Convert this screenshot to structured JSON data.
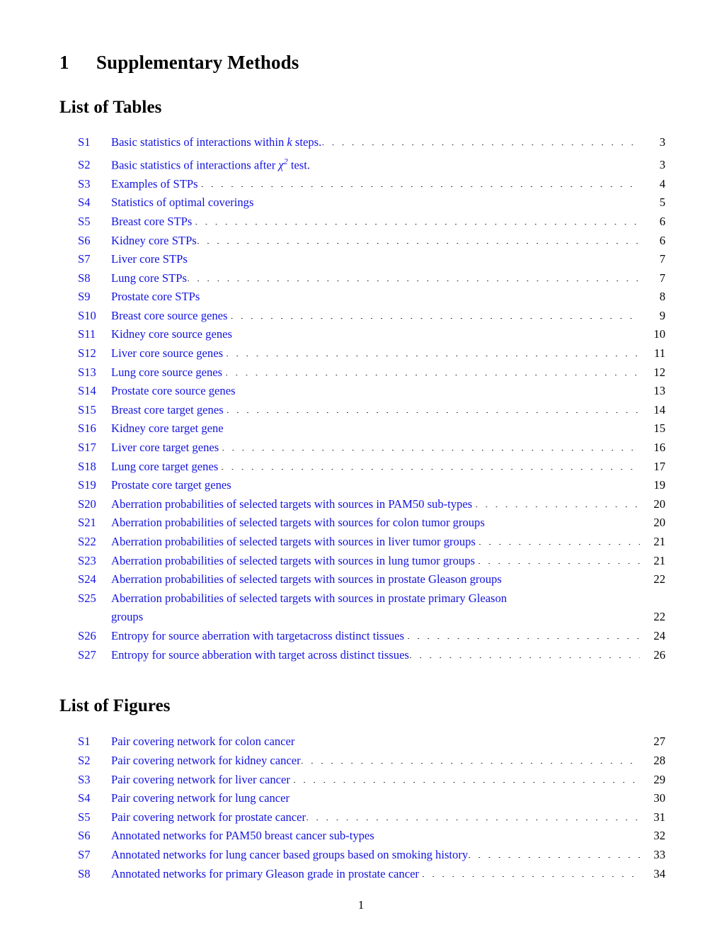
{
  "document": {
    "section_number": "1",
    "section_title": "Supplementary Methods",
    "page_footer": "1",
    "link_color": "#1414e0",
    "text_color": "#000000"
  },
  "tables": {
    "heading": "List of Tables",
    "entries": [
      {
        "label": "S1",
        "title_pre": "Basic statistics of interactions within ",
        "math": "k",
        "title_post": " steps.",
        "page": "3",
        "leader": "tight"
      },
      {
        "label": "S2",
        "title_pre": "Basic statistics of interactions after ",
        "math_chi": "χ",
        "math_sup": "2",
        "title_post": " test.",
        "page": "3",
        "leader": "tight"
      },
      {
        "label": "S3",
        "title": "Examples of STPs",
        "page": "4",
        "leader": "normal"
      },
      {
        "label": "S4",
        "title": "Statistics of optimal coverings",
        "page": "5",
        "leader": "normal"
      },
      {
        "label": "S5",
        "title": "Breast core STPs",
        "page": "6",
        "leader": "normal"
      },
      {
        "label": "S6",
        "title": "Kidney core STPs",
        "page": "6",
        "leader": "tight"
      },
      {
        "label": "S7",
        "title": "Liver core STPs",
        "page": "7",
        "leader": "tight"
      },
      {
        "label": "S8",
        "title": "Lung core STPs",
        "page": "7",
        "leader": "tight"
      },
      {
        "label": "S9",
        "title": "Prostate core STPs",
        "page": "8",
        "leader": "normal"
      },
      {
        "label": "S10",
        "title": "Breast core source genes",
        "page": "9",
        "leader": "normal"
      },
      {
        "label": "S11",
        "title": "Kidney core source genes",
        "page": "10",
        "leader": "normal"
      },
      {
        "label": "S12",
        "title": "Liver core source genes",
        "page": "11",
        "leader": "normal"
      },
      {
        "label": "S13",
        "title": "Lung core source genes",
        "page": "12",
        "leader": "normal"
      },
      {
        "label": "S14",
        "title": "Prostate core source genes",
        "page": "13",
        "leader": "normal"
      },
      {
        "label": "S15",
        "title": "Breast core target genes",
        "page": "14",
        "leader": "normal"
      },
      {
        "label": "S16",
        "title": "Kidney core target gene",
        "page": "15",
        "leader": "normal"
      },
      {
        "label": "S17",
        "title": "Liver core target genes",
        "page": "16",
        "leader": "normal"
      },
      {
        "label": "S18",
        "title": "Lung core target genes",
        "page": "17",
        "leader": "normal"
      },
      {
        "label": "S19",
        "title": "Prostate core target genes",
        "page": "19",
        "leader": "normal"
      },
      {
        "label": "S20",
        "title": "Aberration probabilities of selected targets with sources in PAM50 sub-types",
        "page": "20",
        "leader": "normal"
      },
      {
        "label": "S21",
        "title": "Aberration probabilities of selected targets with sources for colon tumor groups",
        "page": "20",
        "leader": "tight"
      },
      {
        "label": "S22",
        "title": "Aberration probabilities of selected targets with sources in liver tumor groups",
        "page": "21",
        "leader": "normal"
      },
      {
        "label": "S23",
        "title": "Aberration probabilities of selected targets with sources in lung tumor groups",
        "page": "21",
        "leader": "normal"
      },
      {
        "label": "S24",
        "title": "Aberration probabilities of selected targets with sources in prostate Gleason groups",
        "page": "22",
        "leader": "normal"
      },
      {
        "label": "S25",
        "title": "Aberration probabilities of selected targets with sources in prostate primary Gleason",
        "continuation": "groups",
        "page": "22",
        "leader": "normal",
        "wrapped": true
      },
      {
        "label": "S26",
        "title": "Entropy for source aberration with targetacross distinct tissues",
        "page": "24",
        "leader": "normal"
      },
      {
        "label": "S27",
        "title": "Entropy for source abberation with target across distinct tissues",
        "page": "26",
        "leader": "tight"
      }
    ]
  },
  "figures": {
    "heading": "List of Figures",
    "entries": [
      {
        "label": "S1",
        "title": "Pair covering network for colon cancer",
        "page": "27",
        "leader": "normal"
      },
      {
        "label": "S2",
        "title": "Pair covering network for kidney cancer",
        "page": "28",
        "leader": "tight"
      },
      {
        "label": "S3",
        "title": "Pair covering network for liver cancer",
        "page": "29",
        "leader": "normal"
      },
      {
        "label": "S4",
        "title": "Pair covering network for lung cancer",
        "page": "30",
        "leader": "normal"
      },
      {
        "label": "S5",
        "title": "Pair covering network for prostate cancer",
        "page": "31",
        "leader": "tight"
      },
      {
        "label": "S6",
        "title": "Annotated networks for PAM50 breast cancer sub-types",
        "page": "32",
        "leader": "tight"
      },
      {
        "label": "S7",
        "title": "Annotated networks for lung cancer based groups based on smoking history",
        "page": "33",
        "leader": "tight"
      },
      {
        "label": "S8",
        "title": "Annotated networks for primary Gleason grade in prostate cancer",
        "page": "34",
        "leader": "normal"
      }
    ]
  }
}
